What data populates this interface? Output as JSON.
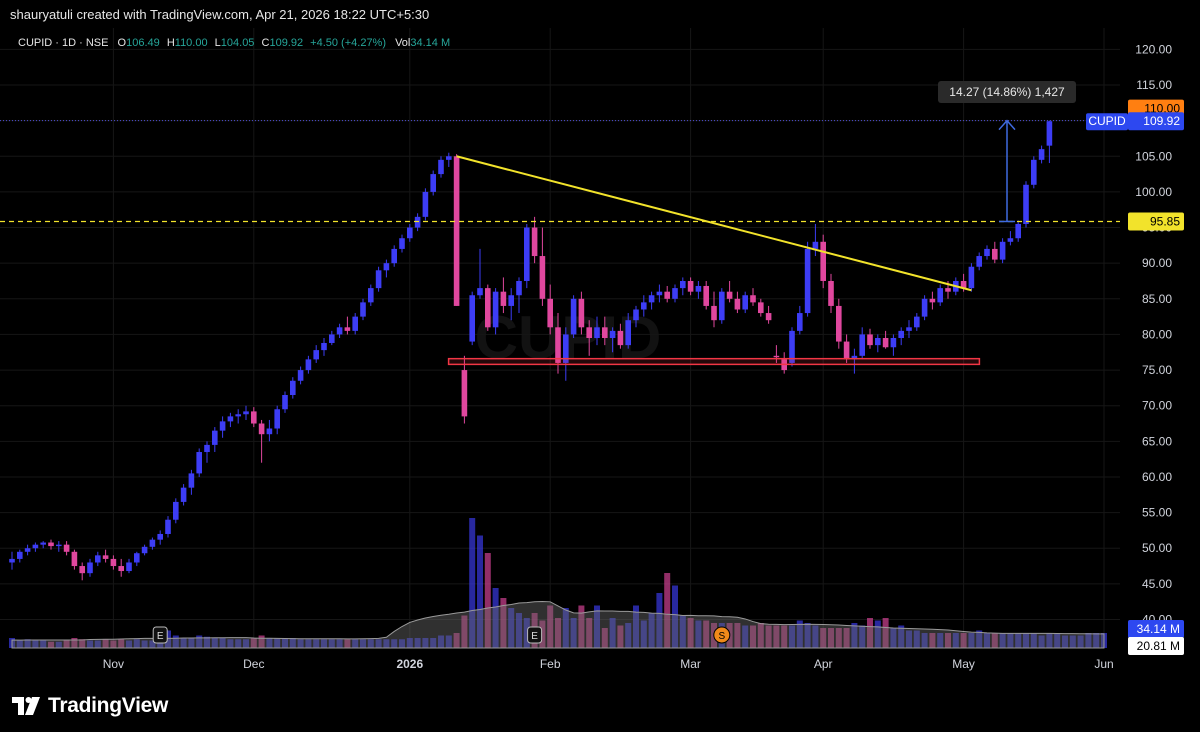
{
  "header": {
    "credit": "shauryatuli created with TradingView.com, Apr 21, 2026 18:22 UTC+5:30"
  },
  "legend": {
    "symbol": "CUPID · 1D · NSE",
    "open_label": "O",
    "open": "106.49",
    "high_label": "H",
    "high": "110.00",
    "low_label": "L",
    "low": "104.05",
    "close_label": "C",
    "close": "109.92",
    "change": "+4.50 (+4.27%)",
    "vol_label": "Vol",
    "vol": "34.14 M"
  },
  "watermark": "CUPID",
  "measure_label": "14.27 (14.86%) 1,427",
  "price_badges": {
    "high_value": "110.00",
    "symbol_tag": "CUPID",
    "last_value": "109.92",
    "level_value": "95.85",
    "vol_badge": "34.14 M",
    "vol_avg_badge": "20.81 M"
  },
  "event_markers": [
    "E",
    "E",
    "S"
  ],
  "footer": {
    "brand": "TradingView"
  },
  "colors": {
    "up": "#3d3df5",
    "down": "#e0479e",
    "trendline": "#f2e32b",
    "support_box": "#f23645",
    "level_line": "#f2e32b",
    "badge_orange": "#ff7f11",
    "badge_blue": "#2d48f0"
  },
  "chart_data": {
    "type": "candlestick",
    "y_range": [
      36,
      123
    ],
    "y_ticks": [
      "120.00",
      "115.00",
      "110.00",
      "105.00",
      "100.00",
      "95.00",
      "90.00",
      "85.00",
      "80.00",
      "75.00",
      "70.00",
      "65.00",
      "60.00",
      "55.00",
      "50.00",
      "45.00",
      "40.00"
    ],
    "x_labels": [
      "Nov",
      "Dec",
      "2026",
      "Feb",
      "Mar",
      "Apr",
      "May",
      "Jun"
    ],
    "series": [
      {
        "o": 48,
        "h": 49.5,
        "l": 47,
        "c": 48.5
      },
      {
        "o": 48.5,
        "h": 49.8,
        "l": 48,
        "c": 49.5
      },
      {
        "o": 49.5,
        "h": 50.5,
        "l": 49,
        "c": 50
      },
      {
        "o": 50,
        "h": 50.8,
        "l": 49.5,
        "c": 50.5
      },
      {
        "o": 50.5,
        "h": 51,
        "l": 50,
        "c": 50.8
      },
      {
        "o": 50.8,
        "h": 51.2,
        "l": 49.8,
        "c": 50.3
      },
      {
        "o": 50.3,
        "h": 51,
        "l": 49.5,
        "c": 50.5
      },
      {
        "o": 50.5,
        "h": 51,
        "l": 49,
        "c": 49.5
      },
      {
        "o": 49.5,
        "h": 49.8,
        "l": 47,
        "c": 47.5
      },
      {
        "o": 47.5,
        "h": 48,
        "l": 45.5,
        "c": 46.5
      },
      {
        "o": 46.5,
        "h": 48.5,
        "l": 46,
        "c": 48
      },
      {
        "o": 48,
        "h": 49.5,
        "l": 47.5,
        "c": 49
      },
      {
        "o": 49,
        "h": 49.8,
        "l": 48,
        "c": 48.5
      },
      {
        "o": 48.5,
        "h": 49,
        "l": 47,
        "c": 47.5
      },
      {
        "o": 47.5,
        "h": 48.5,
        "l": 46,
        "c": 46.8
      },
      {
        "o": 46.8,
        "h": 48.5,
        "l": 46.5,
        "c": 48
      },
      {
        "o": 48,
        "h": 49.5,
        "l": 47.5,
        "c": 49.3
      },
      {
        "o": 49.3,
        "h": 50.5,
        "l": 49,
        "c": 50.2
      },
      {
        "o": 50.2,
        "h": 51.5,
        "l": 49.8,
        "c": 51.2
      },
      {
        "o": 51.2,
        "h": 52.5,
        "l": 50.5,
        "c": 52
      },
      {
        "o": 52,
        "h": 54.5,
        "l": 51.5,
        "c": 54
      },
      {
        "o": 54,
        "h": 57,
        "l": 53.5,
        "c": 56.5
      },
      {
        "o": 56.5,
        "h": 59,
        "l": 56,
        "c": 58.5
      },
      {
        "o": 58.5,
        "h": 61,
        "l": 57.5,
        "c": 60.5
      },
      {
        "o": 60.5,
        "h": 64,
        "l": 60,
        "c": 63.5
      },
      {
        "o": 63.5,
        "h": 65,
        "l": 62,
        "c": 64.5
      },
      {
        "o": 64.5,
        "h": 67,
        "l": 63.5,
        "c": 66.5
      },
      {
        "o": 66.5,
        "h": 68.5,
        "l": 65.5,
        "c": 67.8
      },
      {
        "o": 67.8,
        "h": 69,
        "l": 67,
        "c": 68.5
      },
      {
        "o": 68.5,
        "h": 69.5,
        "l": 67.5,
        "c": 68.8
      },
      {
        "o": 68.8,
        "h": 70,
        "l": 68,
        "c": 69.2
      },
      {
        "o": 69.2,
        "h": 69.8,
        "l": 67,
        "c": 67.5
      },
      {
        "o": 67.5,
        "h": 68,
        "l": 62,
        "c": 66
      },
      {
        "o": 66,
        "h": 68,
        "l": 65,
        "c": 66.8
      },
      {
        "o": 66.8,
        "h": 70,
        "l": 66,
        "c": 69.5
      },
      {
        "o": 69.5,
        "h": 72,
        "l": 69,
        "c": 71.5
      },
      {
        "o": 71.5,
        "h": 74,
        "l": 71,
        "c": 73.5
      },
      {
        "o": 73.5,
        "h": 75.5,
        "l": 73,
        "c": 75
      },
      {
        "o": 75,
        "h": 77,
        "l": 74.5,
        "c": 76.5
      },
      {
        "o": 76.5,
        "h": 78.5,
        "l": 76,
        "c": 77.8
      },
      {
        "o": 77.8,
        "h": 79.5,
        "l": 77,
        "c": 78.8
      },
      {
        "o": 78.8,
        "h": 80.5,
        "l": 78.5,
        "c": 80
      },
      {
        "o": 80,
        "h": 81.5,
        "l": 79.5,
        "c": 81
      },
      {
        "o": 81,
        "h": 82.5,
        "l": 80,
        "c": 80.5
      },
      {
        "o": 80.5,
        "h": 83,
        "l": 80,
        "c": 82.5
      },
      {
        "o": 82.5,
        "h": 85,
        "l": 82,
        "c": 84.5
      },
      {
        "o": 84.5,
        "h": 87,
        "l": 84,
        "c": 86.5
      },
      {
        "o": 86.5,
        "h": 89.5,
        "l": 86,
        "c": 89
      },
      {
        "o": 89,
        "h": 90.5,
        "l": 88,
        "c": 90
      },
      {
        "o": 90,
        "h": 92.5,
        "l": 89.5,
        "c": 92
      },
      {
        "o": 92,
        "h": 94,
        "l": 91.5,
        "c": 93.5
      },
      {
        "o": 93.5,
        "h": 95.5,
        "l": 93,
        "c": 95
      },
      {
        "o": 95,
        "h": 97,
        "l": 94.5,
        "c": 96.5
      },
      {
        "o": 96.5,
        "h": 100.5,
        "l": 96,
        "c": 100
      },
      {
        "o": 100,
        "h": 103,
        "l": 99.5,
        "c": 102.5
      },
      {
        "o": 102.5,
        "h": 105,
        "l": 102,
        "c": 104.5
      },
      {
        "o": 104.5,
        "h": 105.5,
        "l": 103.5,
        "c": 105
      },
      {
        "o": 105,
        "h": 105.3,
        "l": 84,
        "c": 84
      },
      {
        "o": 75,
        "h": 77,
        "l": 67.5,
        "c": 68.5
      },
      {
        "o": 79,
        "h": 86,
        "l": 78.5,
        "c": 85.5
      },
      {
        "o": 85.5,
        "h": 92,
        "l": 85,
        "c": 86.5
      },
      {
        "o": 86.5,
        "h": 87,
        "l": 80.5,
        "c": 81
      },
      {
        "o": 81,
        "h": 86.5,
        "l": 80,
        "c": 86
      },
      {
        "o": 86,
        "h": 88,
        "l": 83,
        "c": 84
      },
      {
        "o": 84,
        "h": 86.5,
        "l": 82,
        "c": 85.5
      },
      {
        "o": 85.5,
        "h": 88,
        "l": 83,
        "c": 87.5
      },
      {
        "o": 87.5,
        "h": 95.5,
        "l": 86.5,
        "c": 95
      },
      {
        "o": 95,
        "h": 96.5,
        "l": 90,
        "c": 91
      },
      {
        "o": 91,
        "h": 95,
        "l": 84,
        "c": 85
      },
      {
        "o": 85,
        "h": 87,
        "l": 80,
        "c": 81
      },
      {
        "o": 81,
        "h": 83,
        "l": 74.5,
        "c": 76
      },
      {
        "o": 76,
        "h": 81,
        "l": 73.5,
        "c": 80
      },
      {
        "o": 80,
        "h": 85.5,
        "l": 79.5,
        "c": 85
      },
      {
        "o": 85,
        "h": 86,
        "l": 80,
        "c": 81
      },
      {
        "o": 81,
        "h": 82,
        "l": 77,
        "c": 79.5
      },
      {
        "o": 79.5,
        "h": 82.5,
        "l": 78.5,
        "c": 81
      },
      {
        "o": 81,
        "h": 82.5,
        "l": 78.5,
        "c": 79.5
      },
      {
        "o": 79.5,
        "h": 81,
        "l": 77.5,
        "c": 80.5
      },
      {
        "o": 80.5,
        "h": 81.5,
        "l": 78,
        "c": 78.5
      },
      {
        "o": 78.5,
        "h": 83,
        "l": 78,
        "c": 82
      },
      {
        "o": 82,
        "h": 84,
        "l": 81,
        "c": 83.5
      },
      {
        "o": 83.5,
        "h": 85.5,
        "l": 82.5,
        "c": 84.5
      },
      {
        "o": 84.5,
        "h": 86,
        "l": 83.5,
        "c": 85.5
      },
      {
        "o": 85.5,
        "h": 87,
        "l": 84.5,
        "c": 86
      },
      {
        "o": 86,
        "h": 86.8,
        "l": 84.5,
        "c": 85
      },
      {
        "o": 85,
        "h": 87,
        "l": 84.5,
        "c": 86.5
      },
      {
        "o": 86.5,
        "h": 88,
        "l": 85.5,
        "c": 87.5
      },
      {
        "o": 87.5,
        "h": 88,
        "l": 85.5,
        "c": 86
      },
      {
        "o": 86,
        "h": 87.5,
        "l": 85,
        "c": 86.8
      },
      {
        "o": 86.8,
        "h": 87.5,
        "l": 83.5,
        "c": 84
      },
      {
        "o": 84,
        "h": 86,
        "l": 81,
        "c": 82
      },
      {
        "o": 82,
        "h": 86.5,
        "l": 81.5,
        "c": 86
      },
      {
        "o": 86,
        "h": 87.5,
        "l": 84.5,
        "c": 85
      },
      {
        "o": 85,
        "h": 86,
        "l": 83,
        "c": 83.5
      },
      {
        "o": 83.5,
        "h": 86,
        "l": 83,
        "c": 85.5
      },
      {
        "o": 85.5,
        "h": 86.5,
        "l": 84,
        "c": 84.5
      },
      {
        "o": 84.5,
        "h": 85,
        "l": 82.5,
        "c": 83
      },
      {
        "o": 83,
        "h": 84,
        "l": 81.5,
        "c": 82
      },
      {
        "o": 77,
        "h": 78.5,
        "l": 76,
        "c": 76.8
      },
      {
        "o": 76.5,
        "h": 77.5,
        "l": 74.5,
        "c": 75
      },
      {
        "o": 76,
        "h": 81,
        "l": 75.5,
        "c": 80.5
      },
      {
        "o": 80.5,
        "h": 84,
        "l": 80,
        "c": 83
      },
      {
        "o": 83,
        "h": 93,
        "l": 82.5,
        "c": 92
      },
      {
        "o": 92,
        "h": 95.5,
        "l": 91,
        "c": 93
      },
      {
        "o": 93,
        "h": 94,
        "l": 86.5,
        "c": 87.5
      },
      {
        "o": 87.5,
        "h": 88.5,
        "l": 83,
        "c": 84
      },
      {
        "o": 84,
        "h": 85,
        "l": 78,
        "c": 79
      },
      {
        "o": 79,
        "h": 80,
        "l": 76,
        "c": 76.5
      },
      {
        "o": 76.5,
        "h": 78,
        "l": 74.5,
        "c": 77
      },
      {
        "o": 77,
        "h": 81,
        "l": 76.5,
        "c": 80
      },
      {
        "o": 80,
        "h": 80.8,
        "l": 78,
        "c": 78.5
      },
      {
        "o": 78.5,
        "h": 80,
        "l": 77.5,
        "c": 79.5
      },
      {
        "o": 79.5,
        "h": 80.5,
        "l": 78,
        "c": 78.2
      },
      {
        "o": 78.2,
        "h": 80,
        "l": 77,
        "c": 79.5
      },
      {
        "o": 79.5,
        "h": 81,
        "l": 78.5,
        "c": 80.5
      },
      {
        "o": 80.5,
        "h": 82,
        "l": 79.5,
        "c": 81
      },
      {
        "o": 81,
        "h": 83,
        "l": 80.5,
        "c": 82.5
      },
      {
        "o": 82.5,
        "h": 85.5,
        "l": 82,
        "c": 85
      },
      {
        "o": 85,
        "h": 86,
        "l": 83.5,
        "c": 84.5
      },
      {
        "o": 84.5,
        "h": 87,
        "l": 84,
        "c": 86.5
      },
      {
        "o": 86.5,
        "h": 87.5,
        "l": 85,
        "c": 86
      },
      {
        "o": 86,
        "h": 88,
        "l": 85.5,
        "c": 87.5
      },
      {
        "o": 87.5,
        "h": 88.5,
        "l": 86,
        "c": 86.5
      },
      {
        "o": 86.5,
        "h": 90,
        "l": 86,
        "c": 89.5
      },
      {
        "o": 89.5,
        "h": 91.5,
        "l": 89,
        "c": 91
      },
      {
        "o": 91,
        "h": 92.5,
        "l": 90.5,
        "c": 92
      },
      {
        "o": 92,
        "h": 93,
        "l": 90,
        "c": 90.5
      },
      {
        "o": 90.5,
        "h": 93.5,
        "l": 90,
        "c": 93
      },
      {
        "o": 93,
        "h": 94.5,
        "l": 92.5,
        "c": 93.5
      },
      {
        "o": 93.5,
        "h": 96,
        "l": 93,
        "c": 95.5
      },
      {
        "o": 95.5,
        "h": 101.5,
        "l": 95,
        "c": 101
      },
      {
        "o": 101,
        "h": 105,
        "l": 100.5,
        "c": 104.5
      },
      {
        "o": 104.5,
        "h": 106.5,
        "l": 104,
        "c": 106
      },
      {
        "o": 106.49,
        "h": 110,
        "l": 104.05,
        "c": 109.92
      }
    ],
    "volume": [
      4,
      3,
      3.5,
      3,
      3,
      2.5,
      2.5,
      3,
      4,
      3.5,
      3,
      3,
      3.5,
      3,
      3.5,
      3,
      3.5,
      3,
      3,
      4,
      7,
      5,
      4,
      4,
      5,
      4.5,
      4,
      4,
      3.5,
      3.5,
      3.5,
      4,
      5,
      4,
      4,
      4,
      4,
      3.5,
      3.5,
      3.5,
      3.5,
      3.5,
      3.5,
      3.5,
      3.5,
      3.5,
      3.5,
      3.5,
      3.5,
      3.5,
      3.5,
      4,
      4,
      4,
      4,
      5,
      5,
      6,
      13,
      52,
      45,
      38,
      24,
      20,
      16,
      14,
      12,
      14,
      11,
      17,
      12,
      16,
      12,
      17,
      12,
      17,
      8,
      12,
      9,
      10,
      17,
      11,
      14,
      22,
      30,
      25,
      13,
      12,
      11,
      11,
      10,
      10,
      10,
      10,
      9,
      9,
      10,
      9,
      9,
      9,
      9,
      11,
      10,
      9,
      8,
      8,
      8,
      8,
      10,
      9,
      12,
      11,
      12,
      8,
      9,
      7,
      7,
      6,
      6,
      6,
      6,
      6,
      6,
      6,
      7,
      6,
      6,
      6,
      6,
      6,
      6,
      6,
      5,
      6,
      6,
      5,
      5,
      5,
      6,
      6,
      6
    ],
    "annotations": {
      "trendline_from": [
        57,
        105
      ],
      "trendline_to": [
        123,
        86.2
      ],
      "support_zone": [
        75.8,
        76.6
      ],
      "support_from": 57,
      "support_to": 123,
      "level": 95.85,
      "measure_from": 95.85,
      "measure_to": 110.0
    }
  }
}
